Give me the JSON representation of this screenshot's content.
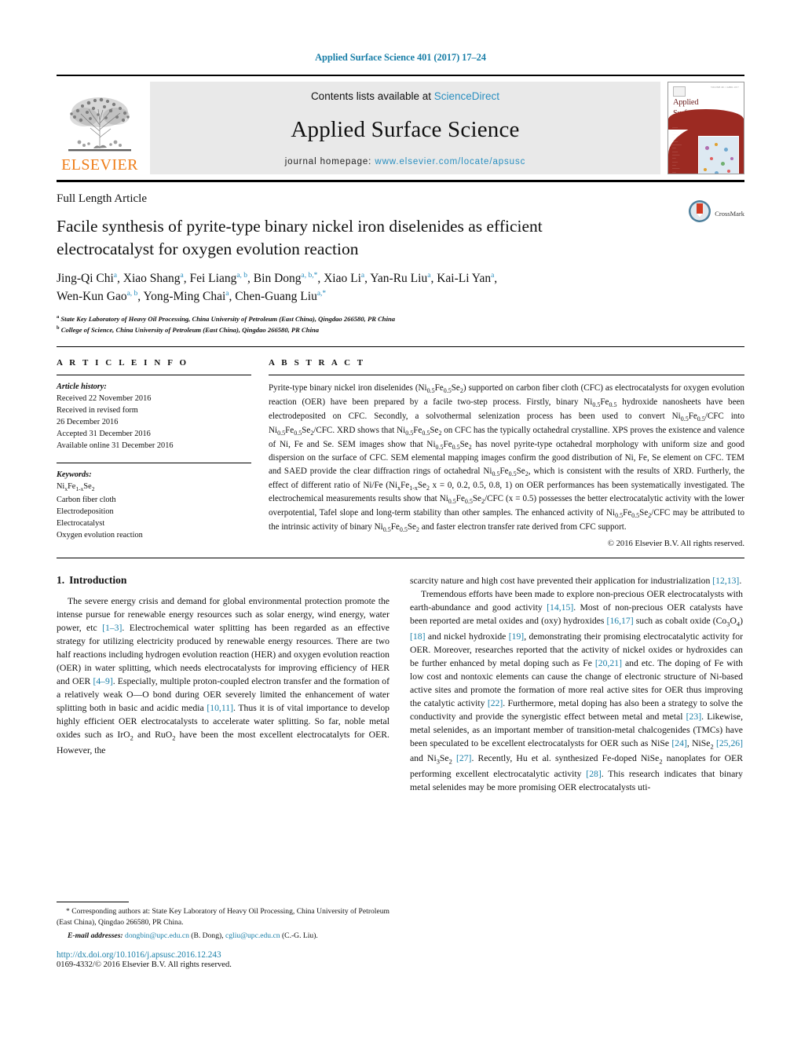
{
  "running_head": "Applied Surface Science 401 (2017) 17–24",
  "masthead": {
    "elsevier_wordmark": "ELSEVIER",
    "contents_prefix": "Contents lists available at ",
    "contents_link": "ScienceDirect",
    "journal_name": "Applied Surface Science",
    "homepage_prefix": "journal homepage: ",
    "homepage_url": "www.elsevier.com/locate/apsusc",
    "cover": {
      "title_line1": "Applied",
      "title_line2": "Surface Science",
      "subtitle": "A JOURNAL DEVOTED TO APPLIED PHYSICS AND CHEMISTRY OF SURFACES AND INTERFACES",
      "volume_note": "VOLUME 401  1 APRIL 2017"
    }
  },
  "article": {
    "type": "Full Length Article",
    "title": "Facile synthesis of pyrite-type binary nickel iron diselenides as efficient electrocatalyst for oxygen evolution reaction",
    "crossmark_label": "CrossMark",
    "authors_line1_parts": [
      {
        "name": "Jing-Qi Chi",
        "sup": "a"
      },
      {
        "name": "Xiao Shang",
        "sup": "a"
      },
      {
        "name": "Fei Liang",
        "sup": "a, b"
      },
      {
        "name": "Bin Dong",
        "sup": "a, b,*"
      },
      {
        "name": "Xiao Li",
        "sup": "a"
      },
      {
        "name": "Yan-Ru Liu",
        "sup": "a"
      },
      {
        "name": "Kai-Li Yan",
        "sup": "a"
      }
    ],
    "authors_line2_parts": [
      {
        "name": "Wen-Kun Gao",
        "sup": "a, b"
      },
      {
        "name": "Yong-Ming Chai",
        "sup": "a"
      },
      {
        "name": "Chen-Guang Liu",
        "sup": "a,*"
      }
    ],
    "affiliations": [
      {
        "marker": "a",
        "text": "State Key Laboratory of Heavy Oil Processing, China University of Petroleum (East China), Qingdao 266580, PR China"
      },
      {
        "marker": "b",
        "text": "College of Science, China University of Petroleum (East China), Qingdao 266580, PR China"
      }
    ]
  },
  "info": {
    "label": "A R T I C L E     I N F O",
    "history_label": "Article history:",
    "history": [
      "Received 22 November 2016",
      "Received in revised form",
      "26 December 2016",
      "Accepted 31 December 2016",
      "Available online 31 December 2016"
    ],
    "keywords_label": "Keywords:",
    "keywords": [
      "NixFe1-xSe2",
      "Carbon fiber cloth",
      "Electrodeposition",
      "Electrocatalyst",
      "Oxygen evolution reaction"
    ]
  },
  "abstract": {
    "label": "A B S T R A C T",
    "text": "Pyrite-type binary nickel iron diselenides (Ni0.5Fe0.5Se2) supported on carbon fiber cloth (CFC) as electrocatalysts for oxygen evolution reaction (OER) have been prepared by a facile two-step process. Firstly, binary Ni0.5Fe0.5 hydroxide nanosheets have been electrodeposited on CFC. Secondly, a solvothermal selenization process has been used to convert Ni0.5Fe0.5/CFC into Ni0.5Fe0.5Se2/CFC. XRD shows that Ni0.5Fe0.5Se2 on CFC has the typically octahedral crystalline. XPS proves the existence and valence of Ni, Fe and Se. SEM images show that Ni0.5Fe0.5Se2 has novel pyrite-type octahedral morphology with uniform size and good dispersion on the surface of CFC. SEM elemental mapping images confirm the good distribution of Ni, Fe, Se element on CFC. TEM and SAED provide the clear diffraction rings of octahedral Ni0.5Fe0.5Se2, which is consistent with the results of XRD. Furtherly, the effect of different ratio of Ni/Fe (NixFe1-xSe2 x = 0, 0.2, 0.5, 0.8, 1) on OER performances has been systematically investigated. The electrochemical measurements results show that Ni0.5Fe0.5Se2/CFC (x = 0.5) possesses the better electrocatalytic activity with the lower overpotential, Tafel slope and long-term stability than other samples. The enhanced activity of Ni0.5Fe0.5Se2/CFC may be attributed to the intrinsic activity of binary Ni0.5Fe0.5Se2 and faster electron transfer rate derived from CFC support.",
    "copyright": "© 2016 Elsevier B.V. All rights reserved."
  },
  "introduction": {
    "number": "1.",
    "heading": "Introduction",
    "left_para_1": "The severe energy crisis and demand for global environmental protection promote the intense pursue for renewable energy resources such as solar energy, wind energy, water power, etc [1–3]. Electrochemical water splitting has been regarded as an effective strategy for utilizing electricity produced by renewable energy resources. There are two half reactions including hydrogen evolution reaction (HER) and oxygen evolution reaction (OER) in water splitting, which needs electrocatalysts for improving efficiency of HER and OER [4–9]. Especially, multiple proton-coupled electron transfer and the formation of a relatively weak O—O bond during OER severely limited the enhancement of water splitting both in basic and acidic media [10,11]. Thus it is of vital importance to develop highly efficient OER electrocatalysts to accelerate water splitting. So far, noble metal oxides such as IrO2 and RuO2 have been the most excellent electrocatalyts for OER. However, the",
    "right_para_1": "scarcity nature and high cost have prevented their application for industrialization [12,13].",
    "right_para_2": "Tremendous efforts have been made to explore non-precious OER electrocatalysts with earth-abundance and good activity [14,15]. Most of non-precious OER catalysts have been reported are metal oxides and (oxy) hydroxides [16,17] such as cobalt oxide (Co3O4) [18] and nickel hydroxide [19], demonstrating their promising electrocatalytic activity for OER. Moreover, researches reported that the activity of nickel oxides or hydroxides can be further enhanced by metal doping such as Fe [20,21] and etc. The doping of Fe with low cost and nontoxic elements can cause the change of electronic structure of Ni-based active sites and promote the formation of more real active sites for OER thus improving the catalytic activity [22]. Furthermore, metal doping has also been a strategy to solve the conductivity and provide the synergistic effect between metal and metal [23]. Likewise, metal selenides, as an important member of transition-metal chalcogenides (TMCs) have been speculated to be excellent electrocatalysts for OER such as NiSe [24], NiSe2 [25,26] and Ni3Se2 [27]. Recently, Hu et al. synthesized Fe-doped NiSe2 nanoplates for OER performing excellent electrocatalytic activity [28]. This research indicates that binary metal selenides may be more promising OER electrocatalysts uti-"
  },
  "footnote": {
    "corresponding": "* Corresponding authors at: State Key Laboratory of Heavy Oil Processing, China University of Petroleum (East China), Qingdao 266580, PR China.",
    "email_label": "E-mail addresses:",
    "email1": "dongbin@upc.edu.cn",
    "email1_owner": "(B. Dong)",
    "email2": "cgliu@upc.edu.cn",
    "email2_owner": "(C.-G. Liu)."
  },
  "doi": {
    "url": "http://dx.doi.org/10.1016/j.apsusc.2016.12.243",
    "issn_line": "0169-4332/© 2016 Elsevier B.V. All rights reserved."
  },
  "colors": {
    "link_blue": "#1a7fa8",
    "sciencedirect_blue": "#2a8fc0",
    "elsevier_orange": "#ef7d18",
    "band_gray": "#e9e9e9",
    "cover_red": "#9c2a22"
  }
}
